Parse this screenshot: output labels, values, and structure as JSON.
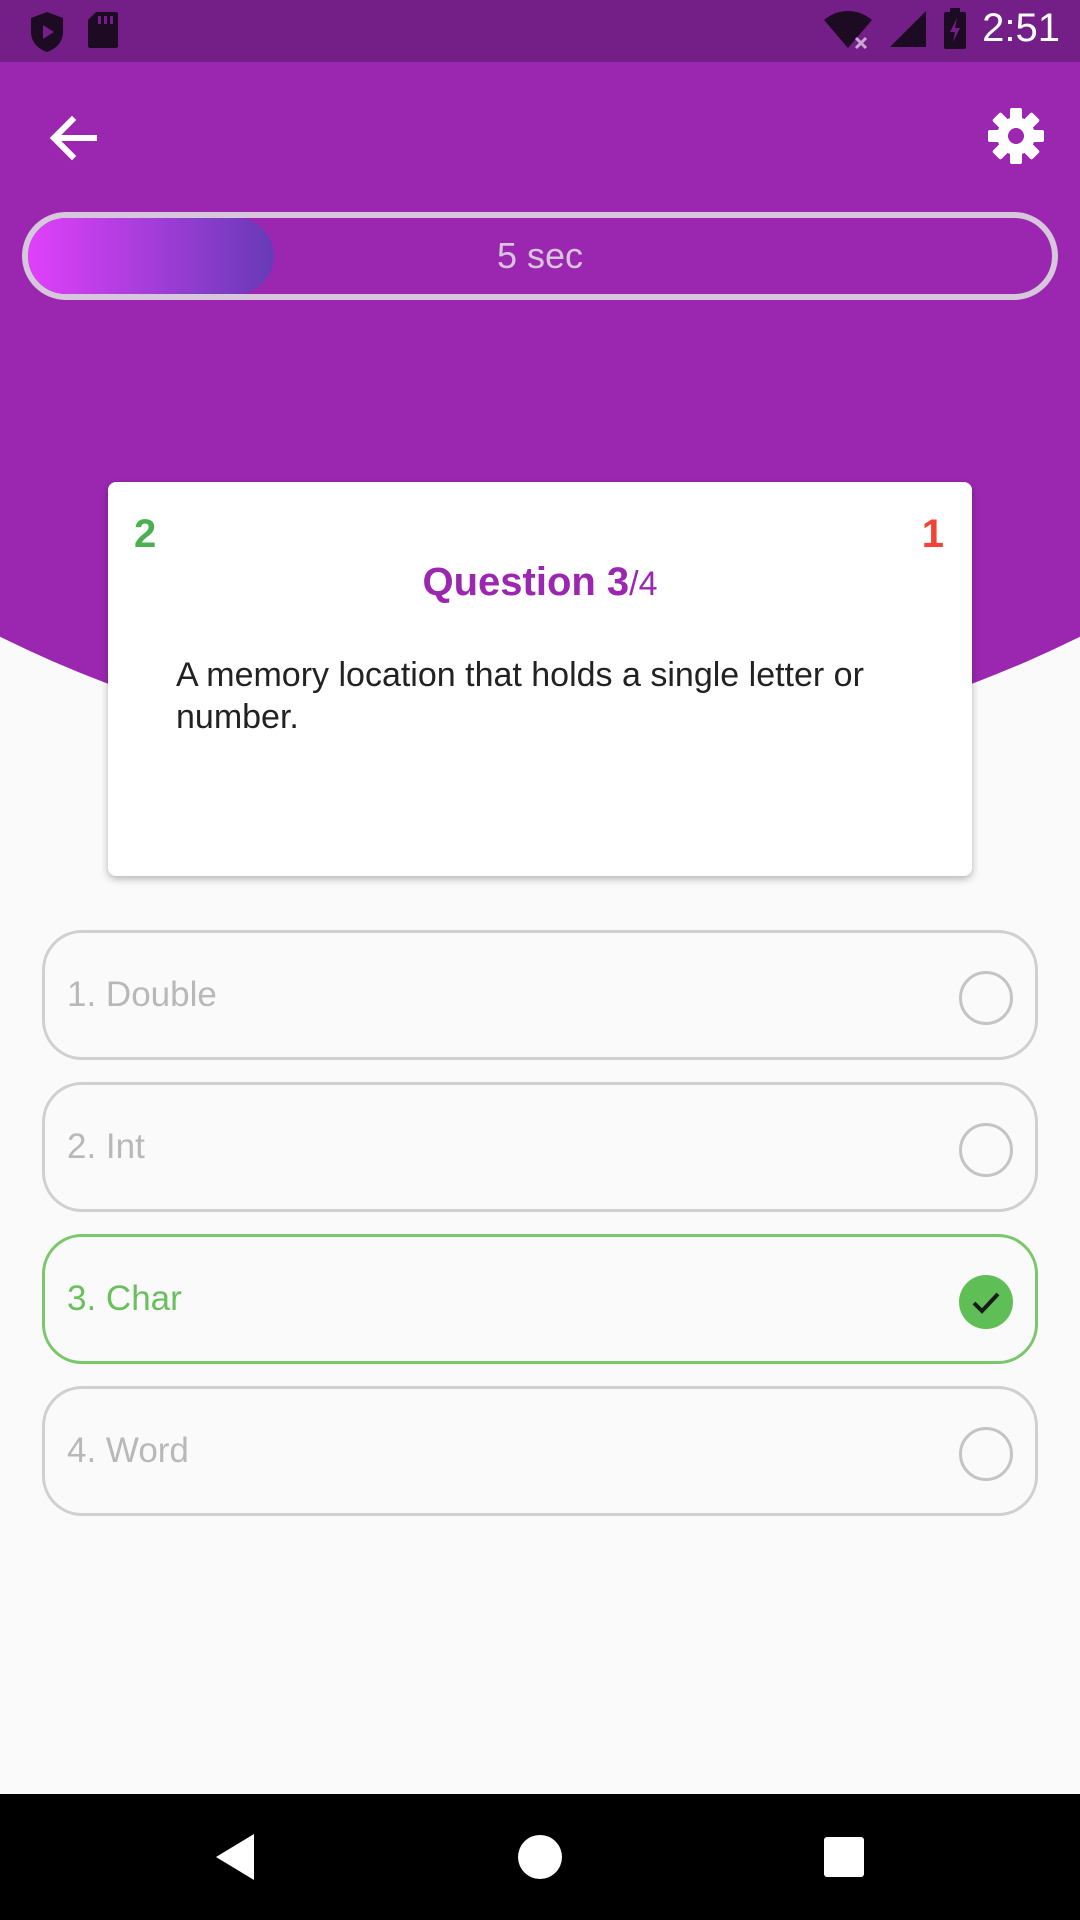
{
  "status_bar": {
    "time": "2:51",
    "left_icons": [
      "shield-play-icon",
      "sd-card-icon"
    ],
    "right_icons": [
      "wifi-icon",
      "cell-signal-icon",
      "battery-charging-icon"
    ]
  },
  "header": {
    "back_icon": "arrow-back-icon",
    "settings_icon": "gear-icon",
    "background_color": "#9b27b0"
  },
  "timer": {
    "label": "5 sec",
    "remaining_fraction": 0.24,
    "gradient_start": "#e040fb",
    "gradient_end": "#673ab7"
  },
  "question_card": {
    "correct_count": "2",
    "wrong_count": "1",
    "title_prefix": "Question 3",
    "title_total": "/4",
    "text": "A memory location that holds a single letter or number."
  },
  "options": [
    {
      "label": "1. Double",
      "selected": false
    },
    {
      "label": "2. Int",
      "selected": false
    },
    {
      "label": "3. Char",
      "selected": true
    },
    {
      "label": "4. Word",
      "selected": false
    }
  ],
  "colors": {
    "correct": "#4caf50",
    "wrong": "#f44336",
    "accent": "#9b27b0"
  },
  "nav_bar": {
    "buttons": [
      "back-triangle-icon",
      "home-circle-icon",
      "recents-square-icon"
    ]
  }
}
